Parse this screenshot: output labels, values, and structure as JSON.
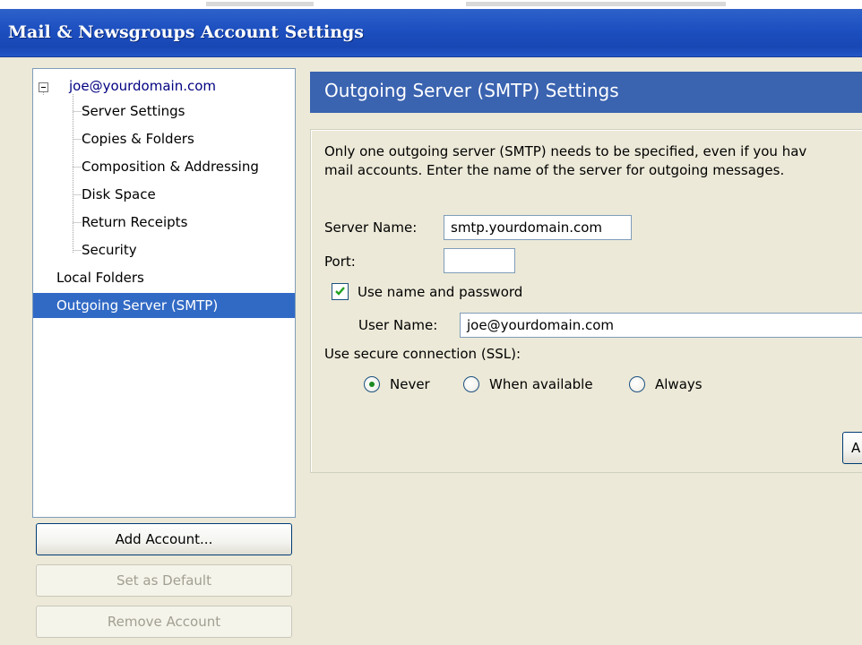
{
  "window": {
    "title": "Mail & Newsgroups Account Settings"
  },
  "tree": {
    "account": "joe@yourdomain.com",
    "children": [
      "Server Settings",
      "Copies & Folders",
      "Composition & Addressing",
      "Disk Space",
      "Return Receipts",
      "Security"
    ],
    "local_folders": "Local Folders",
    "outgoing_server": "Outgoing Server (SMTP)",
    "selected": "Outgoing Server (SMTP)"
  },
  "buttons": {
    "add_account": "Add Account...",
    "set_as_default": "Set as Default",
    "remove_account": "Remove Account",
    "partial": "A"
  },
  "settings": {
    "title": "Outgoing Server (SMTP) Settings",
    "description_line1": "Only one outgoing server (SMTP) needs to be specified, even if you hav",
    "description_line2": "mail accounts. Enter the name of the server for outgoing messages.",
    "server_name_label": "Server Name:",
    "server_name_value": "smtp.yourdomain.com",
    "port_label": "Port:",
    "port_value": "",
    "use_auth_label": "Use name and password",
    "use_auth_checked": true,
    "user_name_label": "User Name:",
    "user_name_value": "joe@yourdomain.com",
    "ssl_label": "Use secure connection (SSL):",
    "ssl_options": [
      "Never",
      "When available",
      "Always"
    ],
    "ssl_selected": "Never"
  },
  "colors": {
    "titlebar": "#1d4fc0",
    "header": "#3a63b0",
    "selection": "#316AC5",
    "dialog_bg": "#ECE9D8"
  }
}
